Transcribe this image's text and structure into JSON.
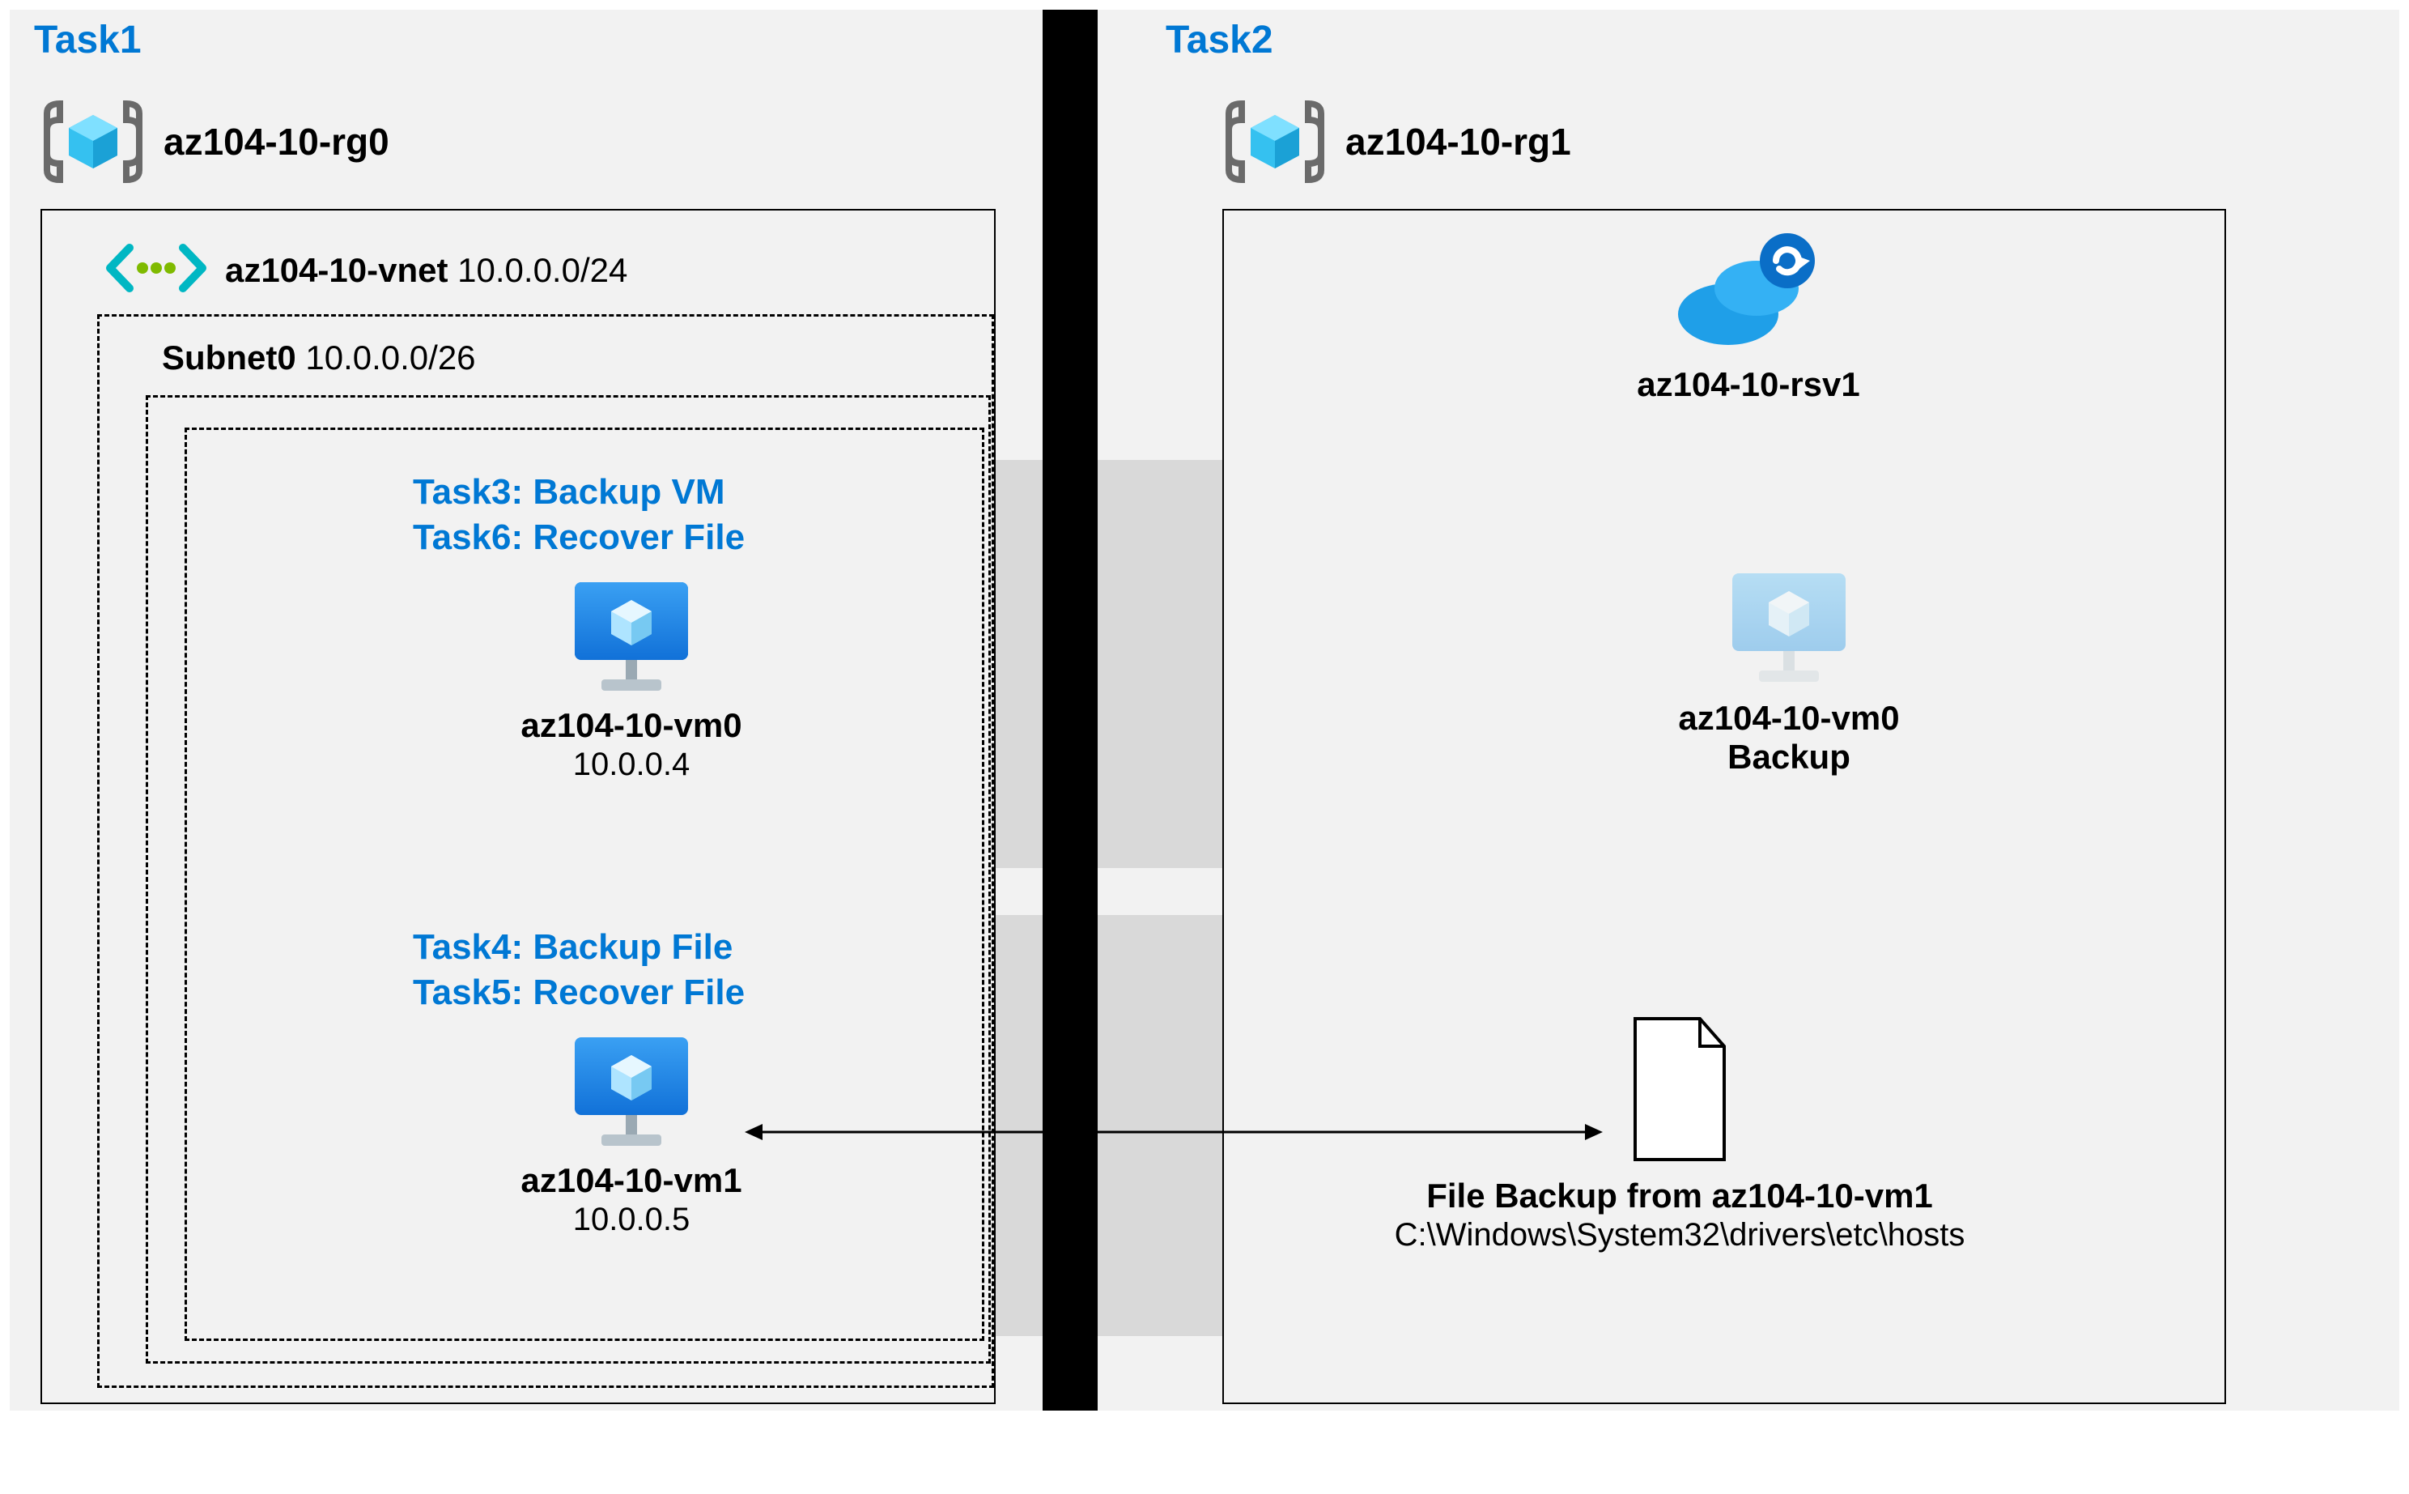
{
  "task1": {
    "label": "Task1"
  },
  "task2": {
    "label": "Task2"
  },
  "rg0": {
    "name": "az104-10-rg0"
  },
  "rg1": {
    "name": "az104-10-rg1"
  },
  "vnet": {
    "name": "az104-10-vnet",
    "cidr": "10.0.0.0/24"
  },
  "subnet": {
    "name": "Subnet0",
    "cidr": "10.0.0.0/26"
  },
  "vm0": {
    "task3": "Task3: Backup VM",
    "task6": "Task6: Recover File",
    "name": "az104-10-vm0",
    "ip": "10.0.0.4"
  },
  "vm1": {
    "task4": "Task4: Backup File",
    "task5": "Task5: Recover File",
    "name": "az104-10-vm1",
    "ip": "10.0.0.5"
  },
  "rsv": {
    "name": "az104-10-rsv1"
  },
  "vm0_backup": {
    "label": "az104-10-vm0 Backup"
  },
  "file_backup": {
    "label": "File Backup from az104-10-vm1",
    "path": "C:\\Windows\\System32\\drivers\\etc\\hosts"
  }
}
